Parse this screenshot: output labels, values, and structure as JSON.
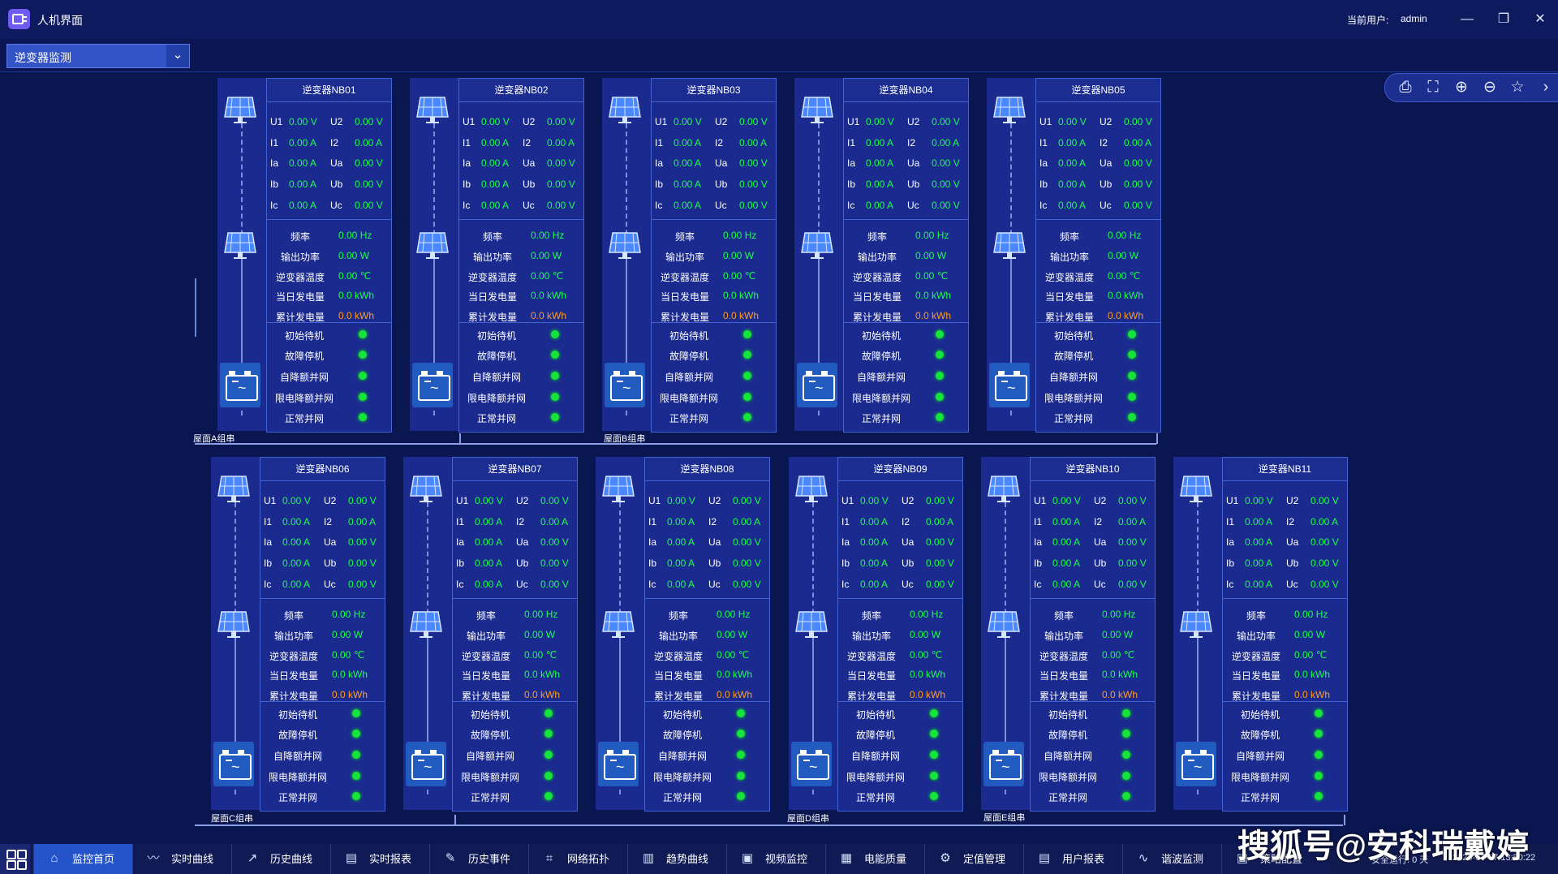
{
  "app": {
    "title": "人机界面",
    "user_label": "当前用户:",
    "user_name": "admin"
  },
  "window_controls": [
    "—",
    "❐",
    "✕"
  ],
  "view_select": {
    "value": "逆变器监测",
    "arrow": "⌄"
  },
  "toolbar": {
    "icons": [
      "print-icon",
      "fullscreen-icon",
      "zoom-in-icon",
      "zoom-out-icon",
      "favorite-star-icon",
      "collapse-arrow-icon"
    ]
  },
  "labels": {
    "top_rows": [
      [
        "U1",
        "U2"
      ],
      [
        "I1",
        "I2"
      ],
      [
        "Ia",
        "Ua"
      ],
      [
        "Ib",
        "Ub"
      ],
      [
        "Ic",
        "Uc"
      ]
    ],
    "detail_rows": [
      "频率",
      "输出功率",
      "逆变器温度",
      "当日发电量",
      "累计发电量"
    ],
    "status_rows": [
      "初始待机",
      "故障停机",
      "自降额并网",
      "限电降额并网",
      "正常并网"
    ]
  },
  "inverters": [
    {
      "title": "逆变器NB01",
      "left_values": [
        "0.00 V",
        "0.00 A",
        "0.00 A",
        "0.00 A",
        "0.00 A"
      ],
      "right_values": [
        "0.00 V",
        "0.00 A",
        "0.00 V",
        "0.00 V",
        "0.00 V"
      ],
      "details": [
        "0.00 Hz",
        "0.00 W",
        "0.00 ℃",
        "0.0 kWh",
        "0.0 kWh"
      ]
    },
    {
      "title": "逆变器NB02",
      "left_values": [
        "0.00 V",
        "0.00 A",
        "0.00 A",
        "0.00 A",
        "0.00 A"
      ],
      "right_values": [
        "0.00 V",
        "0.00 A",
        "0.00 V",
        "0.00 V",
        "0.00 V"
      ],
      "details": [
        "0.00 Hz",
        "0.00 W",
        "0.00 ℃",
        "0.0 kWh",
        "0.0 kWh"
      ]
    },
    {
      "title": "逆变器NB03",
      "left_values": [
        "0.00 V",
        "0.00 A",
        "0.00 A",
        "0.00 A",
        "0.00 A"
      ],
      "right_values": [
        "0.00 V",
        "0.00 A",
        "0.00 V",
        "0.00 V",
        "0.00 V"
      ],
      "details": [
        "0.00 Hz",
        "0.00 W",
        "0.00 ℃",
        "0.0 kWh",
        "0.0 kWh"
      ]
    },
    {
      "title": "逆变器NB04",
      "left_values": [
        "0.00 V",
        "0.00 A",
        "0.00 A",
        "0.00 A",
        "0.00 A"
      ],
      "right_values": [
        "0.00 V",
        "0.00 A",
        "0.00 V",
        "0.00 V",
        "0.00 V"
      ],
      "details": [
        "0.00 Hz",
        "0.00 W",
        "0.00 ℃",
        "0.0 kWh",
        "0.0 kWh"
      ]
    },
    {
      "title": "逆变器NB05",
      "left_values": [
        "0.00 V",
        "0.00 A",
        "0.00 A",
        "0.00 A",
        "0.00 A"
      ],
      "right_values": [
        "0.00 V",
        "0.00 A",
        "0.00 V",
        "0.00 V",
        "0.00 V"
      ],
      "details": [
        "0.00 Hz",
        "0.00 W",
        "0.00 ℃",
        "0.0 kWh",
        "0.0 kWh"
      ]
    },
    {
      "title": "逆变器NB06",
      "left_values": [
        "0.00 V",
        "0.00 A",
        "0.00 A",
        "0.00 A",
        "0.00 A"
      ],
      "right_values": [
        "0.00 V",
        "0.00 A",
        "0.00 V",
        "0.00 V",
        "0.00 V"
      ],
      "details": [
        "0.00 Hz",
        "0.00 W",
        "0.00 ℃",
        "0.0 kWh",
        "0.0 kWh"
      ]
    },
    {
      "title": "逆变器NB07",
      "left_values": [
        "0.00 V",
        "0.00 A",
        "0.00 A",
        "0.00 A",
        "0.00 A"
      ],
      "right_values": [
        "0.00 V",
        "0.00 A",
        "0.00 V",
        "0.00 V",
        "0.00 V"
      ],
      "details": [
        "0.00 Hz",
        "0.00 W",
        "0.00 ℃",
        "0.0 kWh",
        "0.0 kWh"
      ]
    },
    {
      "title": "逆变器NB08",
      "left_values": [
        "0.00 V",
        "0.00 A",
        "0.00 A",
        "0.00 A",
        "0.00 A"
      ],
      "right_values": [
        "0.00 V",
        "0.00 A",
        "0.00 V",
        "0.00 V",
        "0.00 V"
      ],
      "details": [
        "0.00 Hz",
        "0.00 W",
        "0.00 ℃",
        "0.0 kWh",
        "0.0 kWh"
      ]
    },
    {
      "title": "逆变器NB09",
      "left_values": [
        "0.00 V",
        "0.00 A",
        "0.00 A",
        "0.00 A",
        "0.00 A"
      ],
      "right_values": [
        "0.00 V",
        "0.00 A",
        "0.00 V",
        "0.00 V",
        "0.00 V"
      ],
      "details": [
        "0.00 Hz",
        "0.00 W",
        "0.00 ℃",
        "0.0 kWh",
        "0.0 kWh"
      ]
    },
    {
      "title": "逆变器NB10",
      "left_values": [
        "0.00 V",
        "0.00 A",
        "0.00 A",
        "0.00 A",
        "0.00 A"
      ],
      "right_values": [
        "0.00 V",
        "0.00 A",
        "0.00 V",
        "0.00 V",
        "0.00 V"
      ],
      "details": [
        "0.00 Hz",
        "0.00 W",
        "0.00 ℃",
        "0.0 kWh",
        "0.0 kWh"
      ]
    },
    {
      "title": "逆变器NB11",
      "left_values": [
        "0.00 V",
        "0.00 A",
        "0.00 A",
        "0.00 A",
        "0.00 A"
      ],
      "right_values": [
        "0.00 V",
        "0.00 A",
        "0.00 V",
        "0.00 V",
        "0.00 V"
      ],
      "details": [
        "0.00 Hz",
        "0.00 W",
        "0.00 ℃",
        "0.0 kWh",
        "0.0 kWh"
      ]
    }
  ],
  "group_labels": [
    "屋面A组串",
    "屋面B组串",
    "屋面C组串",
    "屋面D组串",
    "屋面E组串"
  ],
  "taskbar": {
    "tabs": [
      {
        "label": "监控首页",
        "icon": "home-icon",
        "active": true
      },
      {
        "label": "实时曲线",
        "icon": "trend-icon"
      },
      {
        "label": "历史曲线",
        "icon": "history-icon"
      },
      {
        "label": "实时报表",
        "icon": "report-icon"
      },
      {
        "label": "历史事件",
        "icon": "edit-icon"
      },
      {
        "label": "网络拓扑",
        "icon": "network-icon"
      },
      {
        "label": "趋势曲线",
        "icon": "chart-icon"
      },
      {
        "label": "视频监控",
        "icon": "video-icon"
      },
      {
        "label": "电能质量",
        "icon": "meter-icon"
      },
      {
        "label": "定值管理",
        "icon": "setting-icon"
      },
      {
        "label": "用户报表",
        "icon": "user-report-icon"
      },
      {
        "label": "谐波监测",
        "icon": "wave-icon"
      },
      {
        "label": "策略配置",
        "icon": "strategy-icon"
      }
    ],
    "safe_run": "安全运行: 0 天",
    "datetime": "2025-04-07 13:50:22"
  },
  "watermark": "搜狐号@安科瑞戴婷",
  "colors": {
    "background": "#0a1650",
    "panel": "#1a2a8f",
    "value_green": "#1dff4c",
    "value_orange": "#ff9c20",
    "accent": "#3254c6"
  }
}
